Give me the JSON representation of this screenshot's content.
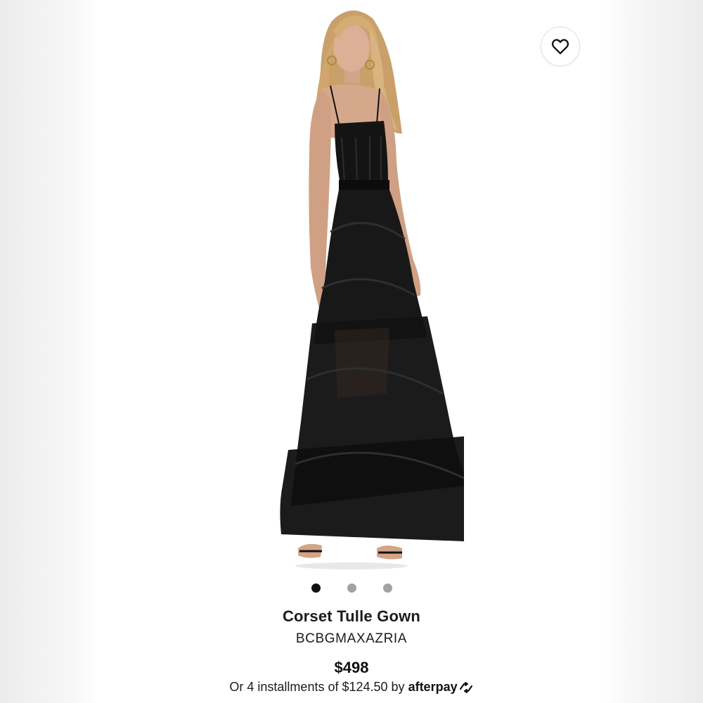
{
  "product": {
    "title": "Corset Tulle Gown",
    "brand": "BCBGMAXAZRIA",
    "price": "$498",
    "installments_text": "Or 4 installments of $124.50 by",
    "afterpay_label": "afterpay"
  },
  "gallery": {
    "image_count": 3,
    "active_index": 0
  },
  "icons": {
    "favorite": "heart-outline-icon",
    "afterpay": "afterpay-arrows-icon"
  },
  "colors": {
    "dot_active": "#111111",
    "dot_inactive": "#a3a3a3",
    "dress": "#141414"
  }
}
